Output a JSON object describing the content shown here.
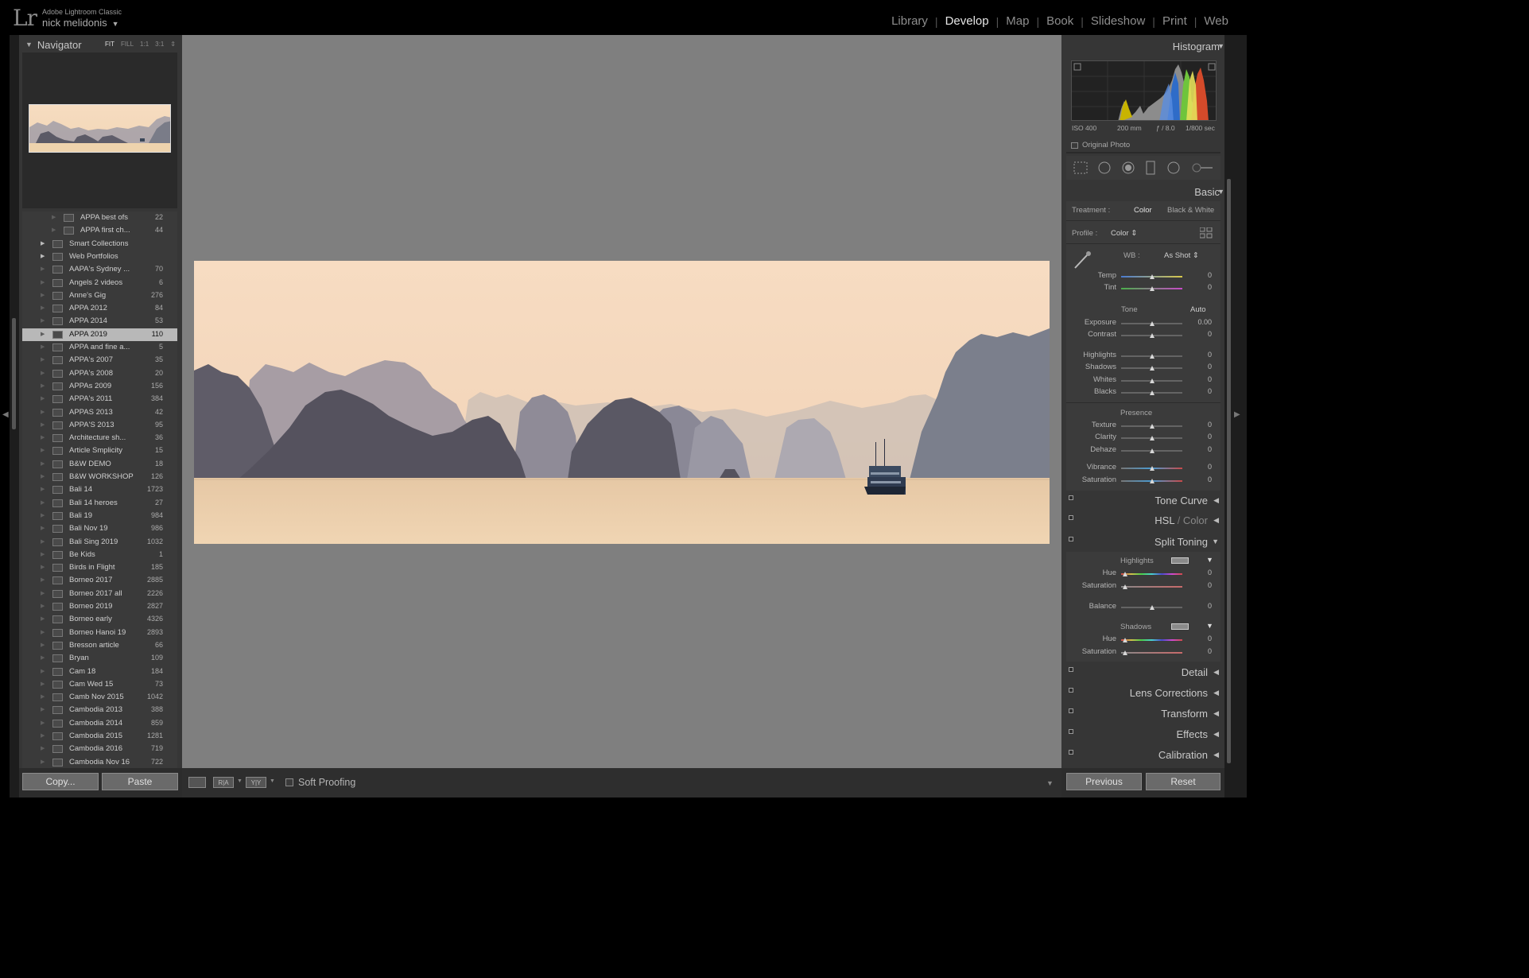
{
  "app": {
    "logo": "Lr",
    "product_name": "Adobe Lightroom Classic",
    "user_name": "nick melidonis",
    "user_caret": "▼"
  },
  "modules": [
    {
      "label": "Library",
      "active": false
    },
    {
      "label": "Develop",
      "active": true
    },
    {
      "label": "Map",
      "active": false
    },
    {
      "label": "Book",
      "active": false
    },
    {
      "label": "Slideshow",
      "active": false
    },
    {
      "label": "Print",
      "active": false
    },
    {
      "label": "Web",
      "active": false
    }
  ],
  "navigator": {
    "title": "Navigator",
    "zoom_options": [
      "FIT",
      "FILL",
      "1:1",
      "3:1"
    ],
    "active_zoom": "FIT"
  },
  "folders": [
    {
      "name": "APPA best ofs",
      "count": "22",
      "sub": true
    },
    {
      "name": "APPA first ch...",
      "count": "44",
      "sub": true
    },
    {
      "name": "Smart Collections",
      "count": "",
      "expand": true
    },
    {
      "name": "Web Portfolios",
      "count": "",
      "expand": true
    },
    {
      "name": "AAPA's Sydney ...",
      "count": "70"
    },
    {
      "name": "Angels 2 videos",
      "count": "6"
    },
    {
      "name": "Anne's Gig",
      "count": "276"
    },
    {
      "name": "APPA 2012",
      "count": "84"
    },
    {
      "name": "APPA 2014",
      "count": "53"
    },
    {
      "name": "APPA 2019",
      "count": "110",
      "selected": true
    },
    {
      "name": "APPA and fine a...",
      "count": "5"
    },
    {
      "name": "APPA's 2007",
      "count": "35"
    },
    {
      "name": "APPA's 2008",
      "count": "20"
    },
    {
      "name": "APPAs 2009",
      "count": "156"
    },
    {
      "name": "APPA's 2011",
      "count": "384"
    },
    {
      "name": "APPAS 2013",
      "count": "42"
    },
    {
      "name": "APPA'S 2013",
      "count": "95"
    },
    {
      "name": "Architecture sh...",
      "count": "36"
    },
    {
      "name": "Article Smplicity",
      "count": "15"
    },
    {
      "name": "B&W DEMO",
      "count": "18"
    },
    {
      "name": "B&W WORKSHOP",
      "count": "126"
    },
    {
      "name": "Bali 14",
      "count": "1723"
    },
    {
      "name": "Bali 14 heroes",
      "count": "27"
    },
    {
      "name": "Bali 19",
      "count": "984"
    },
    {
      "name": "Bali Nov 19",
      "count": "986"
    },
    {
      "name": "Bali Sing 2019",
      "count": "1032"
    },
    {
      "name": "Be Kids",
      "count": "1"
    },
    {
      "name": "Birds in Flight",
      "count": "185"
    },
    {
      "name": "Borneo 2017",
      "count": "2885"
    },
    {
      "name": "Borneo 2017 all",
      "count": "2226"
    },
    {
      "name": "Borneo 2019",
      "count": "2827"
    },
    {
      "name": "Borneo early",
      "count": "4326"
    },
    {
      "name": "Borneo Hanoi 19",
      "count": "2893"
    },
    {
      "name": "Bresson article",
      "count": "66"
    },
    {
      "name": "Bryan",
      "count": "109"
    },
    {
      "name": "Cam 18",
      "count": "184"
    },
    {
      "name": "Cam Wed 15",
      "count": "73"
    },
    {
      "name": "Camb Nov 2015",
      "count": "1042"
    },
    {
      "name": "Cambodia 2013",
      "count": "388"
    },
    {
      "name": "Cambodia 2014",
      "count": "859"
    },
    {
      "name": "Cambodia 2015",
      "count": "1281"
    },
    {
      "name": "Cambodia 2016",
      "count": "719"
    },
    {
      "name": "Cambodia Nov 16",
      "count": "722"
    }
  ],
  "left_buttons": {
    "copy": "Copy...",
    "paste": "Paste"
  },
  "toolbar": {
    "view_icon": "loupe-view-icon",
    "before_after_ra": "R|A",
    "before_after_yy": "Y|Y",
    "soft_proofing": "Soft Proofing"
  },
  "histogram": {
    "title": "Histogram",
    "iso": "ISO 400",
    "focal": "200 mm",
    "aperture": "ƒ / 8.0",
    "shutter": "1/800 sec",
    "original_photo": "Original Photo"
  },
  "basic": {
    "title": "Basic",
    "treatment_label": "Treatment :",
    "treatment_color": "Color",
    "treatment_bw": "Black & White",
    "profile_label": "Profile :",
    "profile_value": "Color ⇕",
    "wb_label": "WB :",
    "wb_value": "As Shot ⇕",
    "temp_label": "Temp",
    "temp_value": "0",
    "tint_label": "Tint",
    "tint_value": "0",
    "tone_label": "Tone",
    "auto_label": "Auto",
    "exposure_label": "Exposure",
    "exposure_value": "0.00",
    "contrast_label": "Contrast",
    "contrast_value": "0",
    "highlights_label": "Highlights",
    "highlights_value": "0",
    "shadows_label": "Shadows",
    "shadows_value": "0",
    "whites_label": "Whites",
    "whites_value": "0",
    "blacks_label": "Blacks",
    "blacks_value": "0",
    "presence_label": "Presence",
    "texture_label": "Texture",
    "texture_value": "0",
    "clarity_label": "Clarity",
    "clarity_value": "0",
    "dehaze_label": "Dehaze",
    "dehaze_value": "0",
    "vibrance_label": "Vibrance",
    "vibrance_value": "0",
    "saturation_label": "Saturation",
    "saturation_value": "0"
  },
  "panels": {
    "tone_curve": "Tone Curve",
    "hsl": "HSL",
    "hsl_sep": " / ",
    "color": "Color",
    "split_toning": "Split Toning",
    "detail": "Detail",
    "lens_corrections": "Lens Corrections",
    "transform": "Transform",
    "effects": "Effects",
    "calibration": "Calibration"
  },
  "split_toning": {
    "highlights_label": "Highlights",
    "hue_label": "Hue",
    "hue_value": "0",
    "saturation_label": "Saturation",
    "saturation_value": "0",
    "balance_label": "Balance",
    "balance_value": "0",
    "shadows_label": "Shadows",
    "sh_hue_label": "Hue",
    "sh_hue_value": "0",
    "sh_saturation_label": "Saturation",
    "sh_saturation_value": "0"
  },
  "right_buttons": {
    "previous": "Previous",
    "reset": "Reset"
  }
}
